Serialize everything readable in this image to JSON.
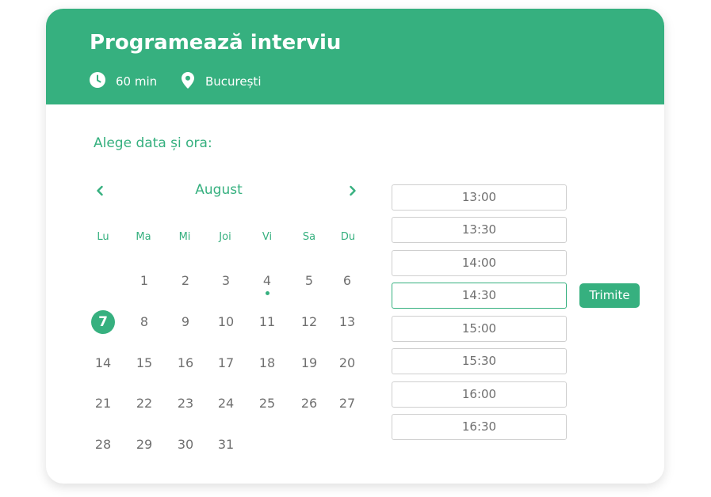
{
  "header": {
    "title": "Programează interviu",
    "duration": "60 min",
    "location": "București"
  },
  "prompt": "Alege data și ora:",
  "calendar": {
    "month": "August",
    "weekdays": [
      "Lu",
      "Ma",
      "Mi",
      "Joi",
      "Vi",
      "Sa",
      "Du"
    ],
    "days": [
      "1",
      "2",
      "3",
      "4",
      "5",
      "6",
      "7",
      "8",
      "9",
      "10",
      "11",
      "12",
      "13",
      "14",
      "15",
      "16",
      "17",
      "18",
      "19",
      "20",
      "21",
      "22",
      "23",
      "24",
      "25",
      "26",
      "27",
      "28",
      "29",
      "30",
      "31"
    ],
    "selected_day": "7",
    "marked_day": "4"
  },
  "time_slots": [
    "13:00",
    "13:30",
    "14:00",
    "14:30",
    "15:00",
    "15:30",
    "16:00",
    "16:30"
  ],
  "selected_slot": "14:30",
  "submit_label": "Trimite",
  "colors": {
    "accent": "#36b07f",
    "text": "#707070",
    "border": "#cfcfcf"
  },
  "icons": {
    "duration": "clock-icon",
    "location": "map-pin-icon",
    "prev": "chevron-left-icon",
    "next": "chevron-right-icon"
  }
}
